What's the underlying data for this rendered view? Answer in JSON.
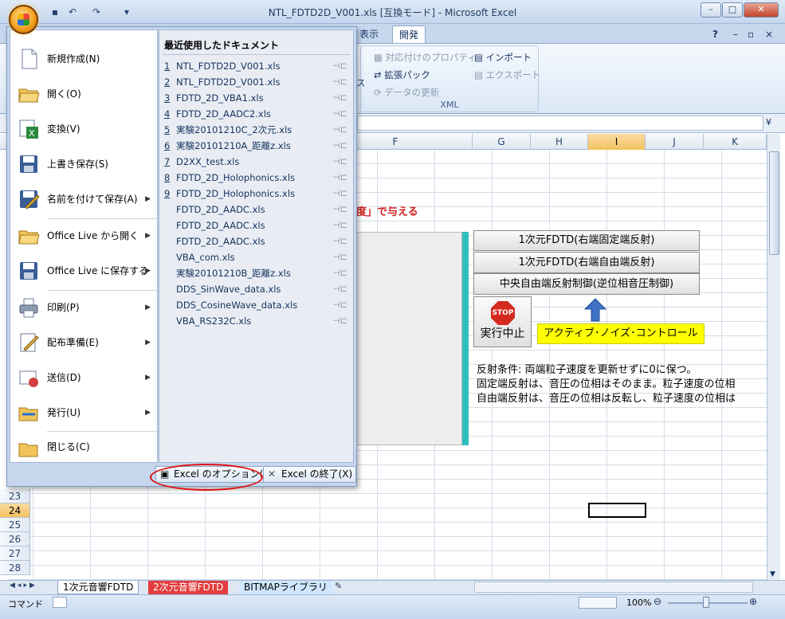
{
  "window": {
    "title": "NTL_FDTD2D_V001.xls  [互換モード] - Microsoft Excel",
    "controls": {
      "minimize": "–",
      "maximize": "□",
      "close": "✕"
    }
  },
  "ribbon": {
    "tabs": [
      "表示",
      "開発"
    ],
    "active_tab": "開発",
    "help": "?",
    "xml_group": {
      "label": "XML",
      "cut_label": "ス",
      "items": [
        "対応付けのプロパティ",
        "拡張パック",
        "データの更新",
        "インポート",
        "エクスポート"
      ]
    }
  },
  "columns": [
    "F",
    "G",
    "H",
    "I",
    "J",
    "K"
  ],
  "selected_column": "I",
  "rows": [
    "23",
    "24",
    "25",
    "26",
    "27",
    "28"
  ],
  "selected_row": "24",
  "sheet": {
    "red_text": "度」で与える",
    "buttons": [
      "1次元FDTD(右端固定端反射)",
      "1次元FDTD(右端自由端反射)",
      "中央自由端反射制御(逆位相音圧制御)"
    ],
    "stop_label": "STOP",
    "stop_button": "実行中止",
    "anc_label": "アクティブ･ノイズ･コントロール",
    "notes": [
      "反射条件: 両端粒子速度を更新せずに0に保つ。",
      "固定端反射は、音圧の位相はそのまま。粒子速度の位相",
      "自由端反射は、音圧の位相は反転し、粒子速度の位相は"
    ]
  },
  "sheet_tabs": [
    "1次元音響FDTD",
    "2次元音響FDTD",
    "BITMAPライブラリ"
  ],
  "status": {
    "mode": "コマンド",
    "zoom": "100%"
  },
  "office_menu": {
    "items": [
      {
        "label": "新規作成(N)",
        "icon": "new-document-icon",
        "arrow": false
      },
      {
        "label": "開く(O)",
        "icon": "open-folder-icon",
        "arrow": false
      },
      {
        "label": "変換(V)",
        "icon": "convert-icon",
        "arrow": false
      },
      {
        "label": "上書き保存(S)",
        "icon": "save-icon",
        "arrow": false
      },
      {
        "label": "名前を付けて保存(A)",
        "icon": "save-as-icon",
        "arrow": true
      },
      {
        "label": "Office Live から開く",
        "icon": "open-folder-icon",
        "arrow": true
      },
      {
        "label": "Office Live に保存する",
        "icon": "save-icon",
        "arrow": true
      },
      {
        "label": "印刷(P)",
        "icon": "printer-icon",
        "arrow": true
      },
      {
        "label": "配布準備(E)",
        "icon": "prepare-icon",
        "arrow": true
      },
      {
        "label": "送信(D)",
        "icon": "send-icon",
        "arrow": true
      },
      {
        "label": "発行(U)",
        "icon": "publish-icon",
        "arrow": true
      },
      {
        "label": "閉じる(C)",
        "icon": "close-folder-icon",
        "arrow": false
      }
    ],
    "recent_title": "最近使用したドキュメント",
    "recent": [
      {
        "num": "1",
        "name": "NTL_FDTD2D_V001.xls"
      },
      {
        "num": "2",
        "name": "NTL_FDTD2D_V001.xls"
      },
      {
        "num": "3",
        "name": "FDTD_2D_VBA1.xls"
      },
      {
        "num": "4",
        "name": "FDTD_2D_AADC2.xls"
      },
      {
        "num": "5",
        "name": "実験20101210C_2次元.xls"
      },
      {
        "num": "6",
        "name": "実験20101210A_距離z.xls"
      },
      {
        "num": "7",
        "name": "D2XX_test.xls"
      },
      {
        "num": "8",
        "name": "FDTD_2D_Holophonics.xls"
      },
      {
        "num": "9",
        "name": "FDTD_2D_Holophonics.xls"
      },
      {
        "num": "",
        "name": "FDTD_2D_AADC.xls"
      },
      {
        "num": "",
        "name": "FDTD_2D_AADC.xls"
      },
      {
        "num": "",
        "name": "FDTD_2D_AADC.xls"
      },
      {
        "num": "",
        "name": "VBA_com.xls"
      },
      {
        "num": "",
        "name": "実験20101210B_距離z.xls"
      },
      {
        "num": "",
        "name": "DDS_SinWave_data.xls"
      },
      {
        "num": "",
        "name": "DDS_CosineWave_data.xls"
      },
      {
        "num": "",
        "name": "VBA_RS232C.xls"
      }
    ],
    "options_button": "Excel のオプション(I)",
    "exit_button": "Excel の終了(X)"
  }
}
